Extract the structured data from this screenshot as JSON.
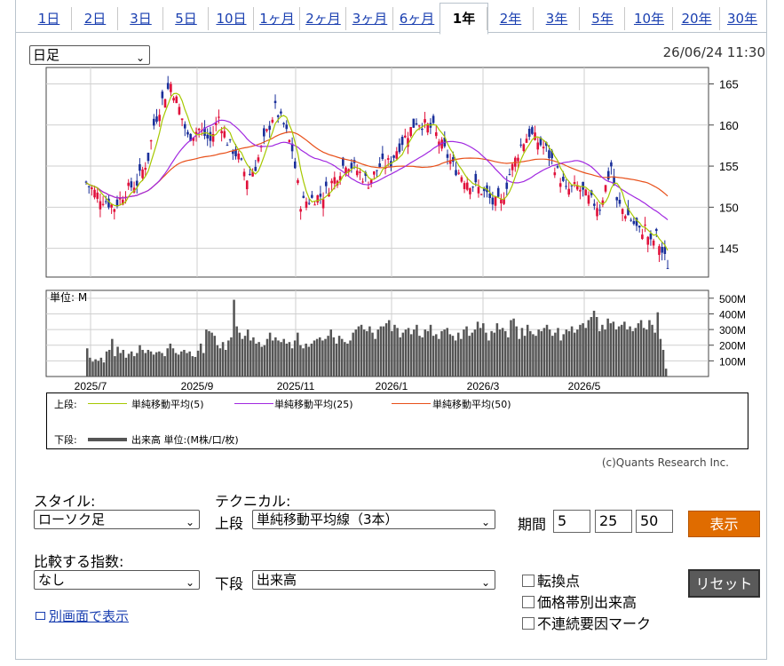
{
  "tabs": [
    "1日",
    "2日",
    "3日",
    "5日",
    "10日",
    "1ヶ月",
    "2ヶ月",
    "3ヶ月",
    "6ヶ月",
    "1年",
    "2年",
    "3年",
    "5年",
    "10年",
    "20年",
    "30年"
  ],
  "active_tab": "1年",
  "chart_header": {
    "period_select": "日足",
    "timestamp": "26/06/24 11:30"
  },
  "unit_label": "単位: M",
  "legend": {
    "upper_label": "上段:",
    "lower_label": "下段:",
    "series": [
      {
        "name": "単純移動平均(5)",
        "color": "#a6c800"
      },
      {
        "name": "単純移動平均(25)",
        "color": "#a128e0"
      },
      {
        "name": "単純移動平均(50)",
        "color": "#e8501a"
      }
    ],
    "volume": {
      "name": "出来高 単位:(M株/口/枚)",
      "color": "#555555"
    }
  },
  "credit": "(c)Quants Research Inc.",
  "chart_data": {
    "type": "candlestick",
    "price_axis": {
      "ticks": [
        165,
        160,
        155,
        150,
        145
      ],
      "range": [
        141.5,
        167
      ]
    },
    "volume_axis": {
      "ticks": [
        "500M",
        "400M",
        "300M",
        "200M",
        "100M"
      ],
      "range": [
        0,
        550
      ]
    },
    "x_labels": [
      "2025/7",
      "2025/9",
      "2025/11",
      "2026/1",
      "2026/3",
      "2026/5"
    ],
    "price_path": [
      [
        0,
        153.0
      ],
      [
        4,
        151.5
      ],
      [
        10,
        150.0
      ],
      [
        14,
        152.0
      ],
      [
        18,
        153.0
      ],
      [
        22,
        156.0
      ],
      [
        24,
        160.0
      ],
      [
        27,
        163.0
      ],
      [
        30,
        165.0
      ],
      [
        33,
        162.0
      ],
      [
        36,
        158.5
      ],
      [
        40,
        159.5
      ],
      [
        44,
        158.0
      ],
      [
        47,
        161.0
      ],
      [
        50,
        158.0
      ],
      [
        54,
        156.0
      ],
      [
        57,
        153.5
      ],
      [
        60,
        155.0
      ],
      [
        62,
        157.0
      ],
      [
        64,
        159.0
      ],
      [
        67,
        162.0
      ],
      [
        70,
        160.0
      ],
      [
        73,
        157.0
      ],
      [
        76,
        150.5
      ],
      [
        80,
        151.0
      ],
      [
        84,
        151.5
      ],
      [
        88,
        153.5
      ],
      [
        92,
        155.5
      ],
      [
        96,
        154.5
      ],
      [
        100,
        153.0
      ],
      [
        104,
        155.0
      ],
      [
        108,
        155.5
      ],
      [
        110,
        157.0
      ],
      [
        114,
        159.0
      ],
      [
        117,
        160.5
      ],
      [
        120,
        160.0
      ],
      [
        123,
        159.5
      ],
      [
        126,
        157.5
      ],
      [
        130,
        155.0
      ],
      [
        134,
        153.5
      ],
      [
        138,
        152.5
      ],
      [
        142,
        151.5
      ],
      [
        144,
        150.5
      ],
      [
        147,
        150.5
      ],
      [
        150,
        154.0
      ],
      [
        154,
        157.5
      ],
      [
        157,
        159.0
      ],
      [
        160,
        158.0
      ],
      [
        163,
        157.0
      ],
      [
        166,
        155.0
      ],
      [
        170,
        152.0
      ],
      [
        174,
        152.5
      ],
      [
        178,
        151.0
      ],
      [
        182,
        150.0
      ],
      [
        184,
        152.5
      ],
      [
        186,
        155.0
      ],
      [
        188,
        150.5
      ],
      [
        192,
        149.0
      ],
      [
        196,
        147.0
      ],
      [
        198,
        147.5
      ],
      [
        200,
        145.5
      ],
      [
        202,
        146.5
      ],
      [
        204,
        144.5
      ],
      [
        206,
        143.0
      ]
    ],
    "volume_bars_M": [
      180,
      120,
      95,
      110,
      100,
      120,
      90,
      160,
      170,
      240,
      130,
      190,
      150,
      170,
      120,
      145,
      160,
      130,
      150,
      200,
      170,
      150,
      170,
      160,
      140,
      155,
      160,
      150,
      130,
      180,
      210,
      180,
      150,
      140,
      160,
      170,
      150,
      160,
      130,
      125,
      165,
      210,
      150,
      300,
      290,
      280,
      260,
      200,
      180,
      220,
      170,
      230,
      250,
      490,
      320,
      280,
      240,
      260,
      300,
      230,
      250,
      210,
      220,
      190,
      200,
      240,
      280,
      230,
      250,
      230,
      220,
      240,
      210,
      220,
      180,
      230,
      280,
      200,
      180,
      210,
      190,
      210,
      230,
      240,
      250,
      230,
      240,
      260,
      300,
      250,
      210,
      260,
      240,
      220,
      210,
      230,
      280,
      300,
      320,
      330,
      300,
      290,
      320,
      280,
      240,
      300,
      320,
      320,
      340,
      360,
      290,
      330,
      310,
      250,
      280,
      300,
      310,
      270,
      300,
      330,
      260,
      250,
      300,
      290,
      330,
      260,
      270,
      240,
      290,
      300,
      310,
      270,
      260,
      230,
      280,
      240,
      300,
      320,
      260,
      280,
      300,
      350,
      310,
      340,
      280,
      230,
      290,
      280,
      340,
      300,
      310,
      290,
      250,
      360,
      370,
      320,
      240,
      310,
      260,
      330,
      290,
      270,
      260,
      300,
      290,
      310,
      330,
      300,
      260,
      280,
      310,
      230,
      270,
      300,
      290,
      320,
      280,
      300,
      330,
      340,
      310,
      360,
      380,
      420,
      380,
      290,
      330,
      300,
      370,
      340,
      350,
      300,
      320,
      330,
      350,
      300,
      320,
      290,
      310,
      340,
      360,
      310,
      300,
      360,
      330,
      280,
      410,
      240,
      170,
      50
    ]
  },
  "controls": {
    "style_label": "スタイル:",
    "style_value": "ローソク足",
    "technical_label": "テクニカル:",
    "upper_label": "上段",
    "upper_value": "単純移動平均線（3本）",
    "period_label": "期間",
    "periods": [
      "5",
      "25",
      "50"
    ],
    "show_button": "表示",
    "index_label": "比較する指数:",
    "index_value": "なし",
    "lower_label": "下段",
    "lower_value": "出来高",
    "checkboxes": [
      "転換点",
      "価格帯別出来高",
      "不連続要因マーク"
    ],
    "reset_button": "リセット",
    "open_link": "別画面で表示"
  }
}
